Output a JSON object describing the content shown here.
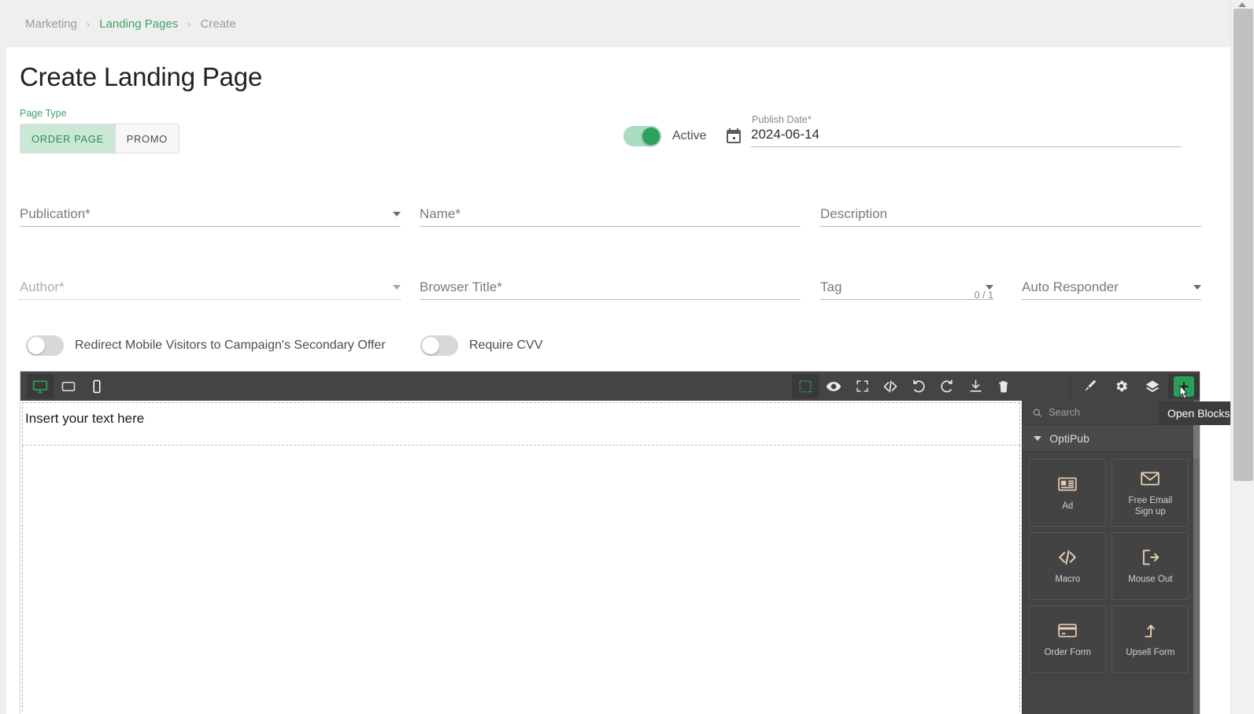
{
  "breadcrumb": {
    "items": [
      {
        "label": "Marketing",
        "type": "muted"
      },
      {
        "label": "Landing Pages",
        "type": "link"
      },
      {
        "label": "Create",
        "type": "muted"
      }
    ],
    "separator": "›"
  },
  "page": {
    "title": "Create Landing Page"
  },
  "page_type": {
    "label": "Page Type",
    "options": [
      "ORDER PAGE",
      "PROMO"
    ],
    "selected": "ORDER PAGE"
  },
  "active_toggle": {
    "label": "Active",
    "state": "on"
  },
  "publish_date": {
    "label": "Publish Date*",
    "value": "2024-06-14",
    "icon": "calendar-icon"
  },
  "fields": {
    "publication": {
      "label": "Publication*",
      "value": "",
      "type": "select"
    },
    "name": {
      "label": "Name*",
      "value": "",
      "type": "text"
    },
    "description": {
      "label": "Description",
      "value": "",
      "type": "text"
    },
    "author": {
      "label": "Author*",
      "value": "",
      "type": "select",
      "disabled": true
    },
    "browser_title": {
      "label": "Browser Title*",
      "value": "",
      "type": "text"
    },
    "tag": {
      "label": "Tag",
      "value": "",
      "type": "select",
      "counter": "0 / 1"
    },
    "auto_responder": {
      "label": "Auto Responder",
      "value": "",
      "type": "select"
    }
  },
  "switches": {
    "redirect_mobile": {
      "label": "Redirect Mobile Visitors to Campaign's Secondary Offer",
      "state": "off"
    },
    "require_cvv": {
      "label": "Require CVV",
      "state": "off"
    }
  },
  "editor": {
    "devices": [
      {
        "name": "desktop-icon",
        "active": true
      },
      {
        "name": "tablet-icon",
        "active": false
      },
      {
        "name": "mobile-icon",
        "active": false
      }
    ],
    "tools": [
      {
        "name": "borders-icon",
        "active": true
      },
      {
        "name": "preview-eye-icon",
        "active": false
      },
      {
        "name": "fullscreen-icon",
        "active": false
      },
      {
        "name": "code-icon",
        "active": false
      },
      {
        "name": "undo-icon",
        "active": false
      },
      {
        "name": "redo-icon",
        "active": false
      },
      {
        "name": "import-download-icon",
        "active": false
      },
      {
        "name": "trash-icon",
        "active": false
      }
    ],
    "panels": [
      {
        "name": "paint-brush-icon"
      },
      {
        "name": "gear-icon"
      },
      {
        "name": "layers-icon"
      },
      {
        "name": "open-blocks-icon"
      }
    ],
    "canvas_text": "Insert your text here"
  },
  "tooltip": {
    "text": "Open Blocks"
  },
  "blocks_panel": {
    "search_placeholder": "Search",
    "category": "OptiPub",
    "blocks": [
      {
        "label": "Ad",
        "icon": "newspaper-icon"
      },
      {
        "label": "Free Email\nSign up",
        "icon": "envelope-icon"
      },
      {
        "label": "Macro",
        "icon": "code-icon"
      },
      {
        "label": "Mouse Out",
        "icon": "exit-arrow-icon"
      },
      {
        "label": "Order Form",
        "icon": "credit-card-icon"
      },
      {
        "label": "Upsell Form",
        "icon": "up-arrow-icon"
      }
    ]
  },
  "colors": {
    "accent_green": "#3ea36a",
    "toggle_on": "#2ba25f",
    "toolbar_bg": "#444444",
    "add_block_green": "#29a05a"
  }
}
